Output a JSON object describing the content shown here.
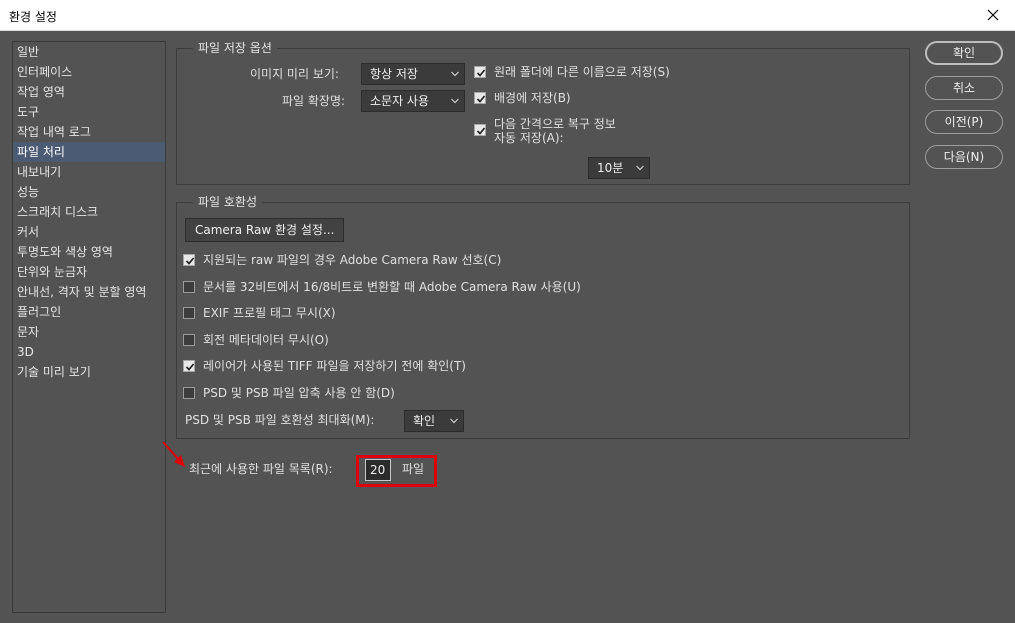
{
  "window": {
    "title": "환경 설정"
  },
  "sidebar": {
    "items": [
      "일반",
      "인터페이스",
      "작업 영역",
      "도구",
      "작업 내역 로그",
      "파일 처리",
      "내보내기",
      "성능",
      "스크래치 디스크",
      "커서",
      "투명도와 색상 영역",
      "단위와 눈금자",
      "안내선, 격자 및 분할 영역",
      "플러그인",
      "문자",
      "3D",
      "기술 미리 보기"
    ],
    "active_index": 5
  },
  "file_save_options": {
    "legend": "파일 저장 옵션",
    "image_preview_label": "이미지 미리 보기:",
    "image_preview_value": "항상 저장",
    "file_extension_label": "파일 확장명:",
    "file_extension_value": "소문자 사용",
    "save_as_original_folder": {
      "label": "원래 폴더에 다른 이름으로 저장(S)",
      "checked": true
    },
    "save_in_background": {
      "label": "배경에 저장(B)",
      "checked": true
    },
    "auto_save": {
      "label_line1": "다음 간격으로 복구 정보",
      "label_line2": "자동 저장(A):",
      "checked": true
    },
    "auto_save_interval": "10분"
  },
  "file_compatibility": {
    "legend": "파일 호환성",
    "camera_raw_button": "Camera Raw 환경 설정...",
    "options": [
      {
        "label": "지원되는 raw 파일의 경우 Adobe Camera Raw 선호(C)",
        "checked": true
      },
      {
        "label": "문서를 32비트에서 16/8비트로 변환할 때 Adobe Camera Raw 사용(U)",
        "checked": false
      },
      {
        "label": "EXIF 프로필 태그 무시(X)",
        "checked": false
      },
      {
        "label": "회전 메타데이터 무시(O)",
        "checked": false
      },
      {
        "label": "레이어가 사용된 TIFF 파일을 저장하기 전에 확인(T)",
        "checked": true
      },
      {
        "label": "PSD 및 PSB 파일 압축 사용 안 함(D)",
        "checked": false
      }
    ],
    "maximize_label": "PSD 및 PSB 파일 호환성 최대화(M):",
    "maximize_value": "확인"
  },
  "recent_files": {
    "label": "최근에 사용한 파일 목록(R):",
    "value": "20",
    "unit": "파일"
  },
  "buttons": {
    "ok": "확인",
    "cancel": "취소",
    "prev": "이전(P)",
    "next": "다음(N)"
  },
  "colors": {
    "highlight": "#e00000",
    "active_item": "#4a5b73",
    "panel_bg": "#535353"
  }
}
